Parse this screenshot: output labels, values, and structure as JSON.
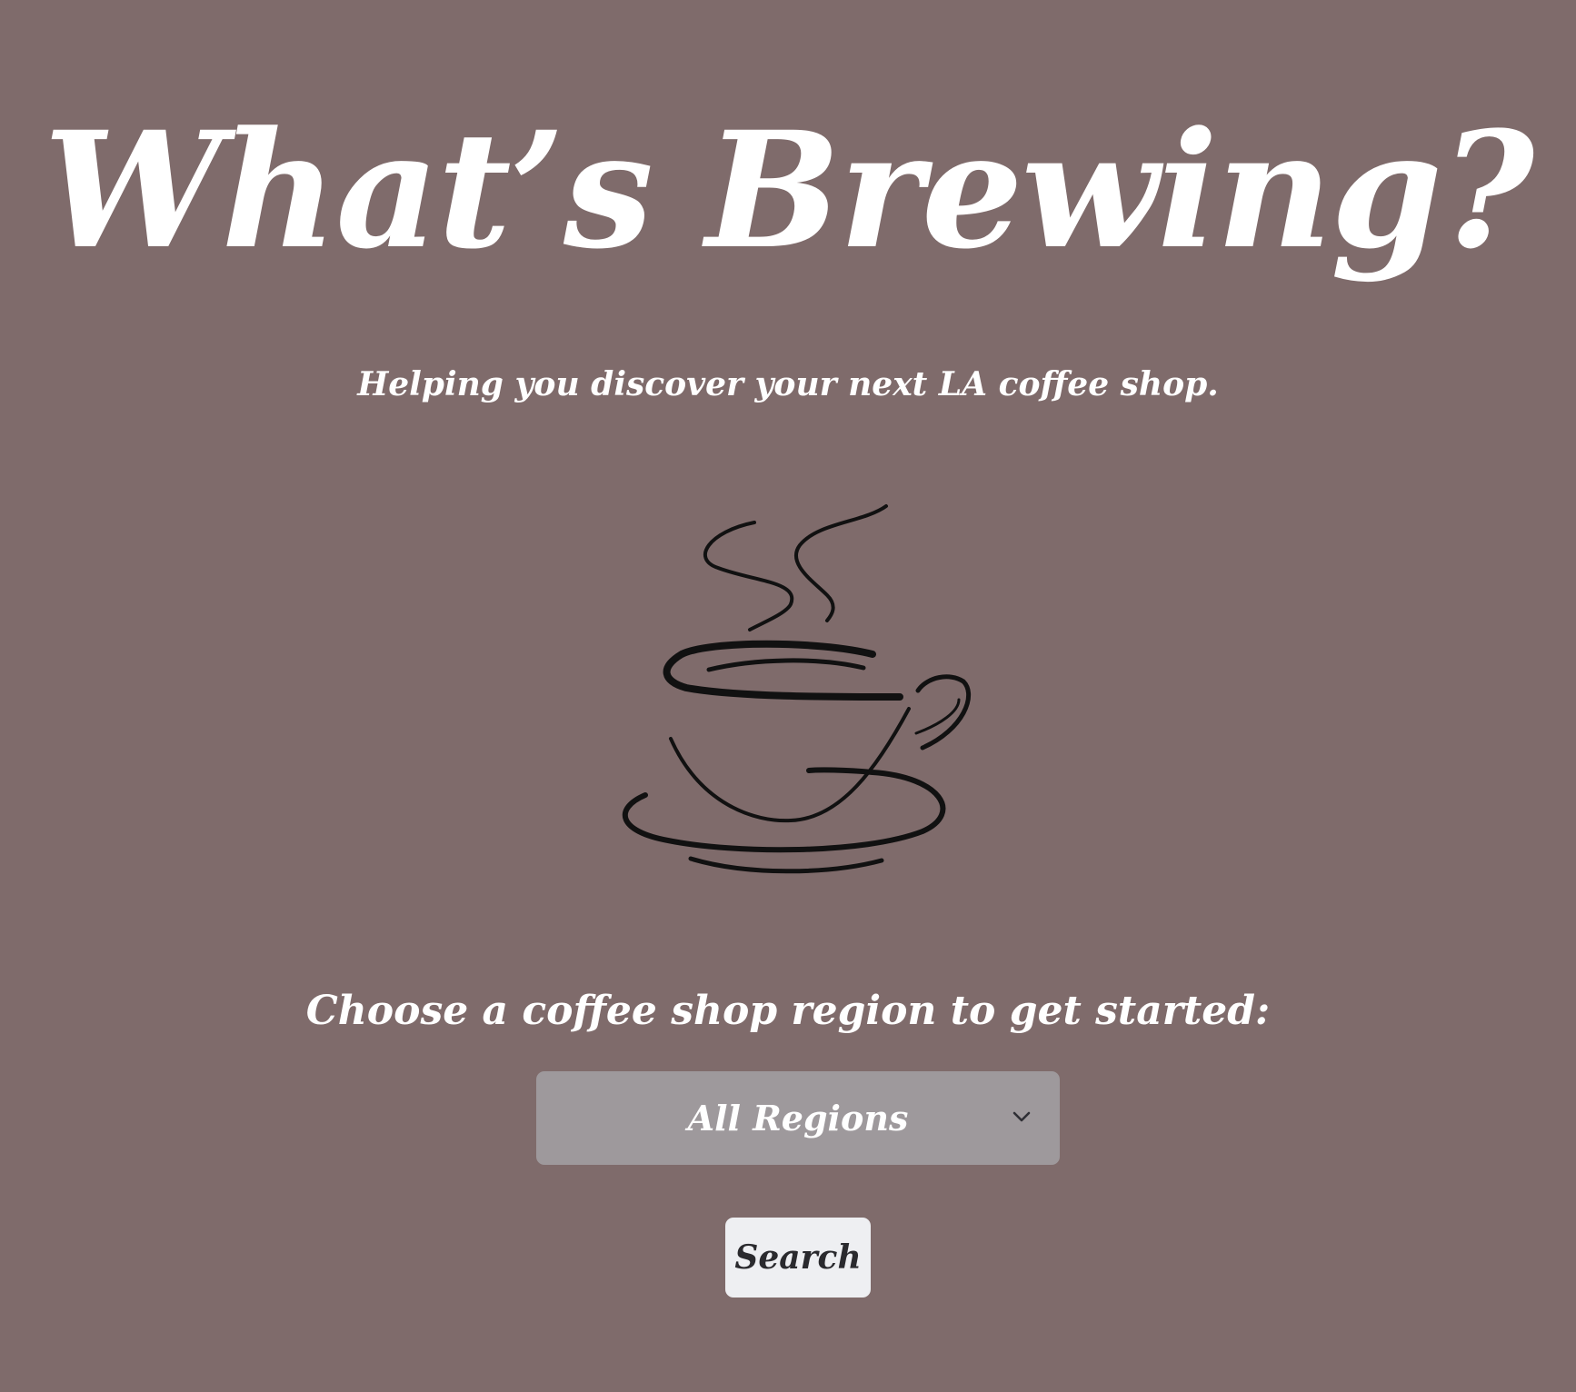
{
  "header": {
    "title": "What’s Brewing?",
    "tagline": "Helping you discover your next LA coffee shop."
  },
  "illustration": {
    "icon": "coffee-cup-icon",
    "stroke_color": "#111111"
  },
  "form": {
    "prompt": "Choose a coffee shop region to get started:",
    "region_select": {
      "selected": "All Regions",
      "icon": "chevron-down-icon"
    },
    "search_label": "Search"
  },
  "colors": {
    "background": "#7f6b6b",
    "select_background": "#9e999c",
    "button_background": "#eeeff2",
    "text_light": "#ffffff",
    "text_dark": "#2a2a2e"
  }
}
